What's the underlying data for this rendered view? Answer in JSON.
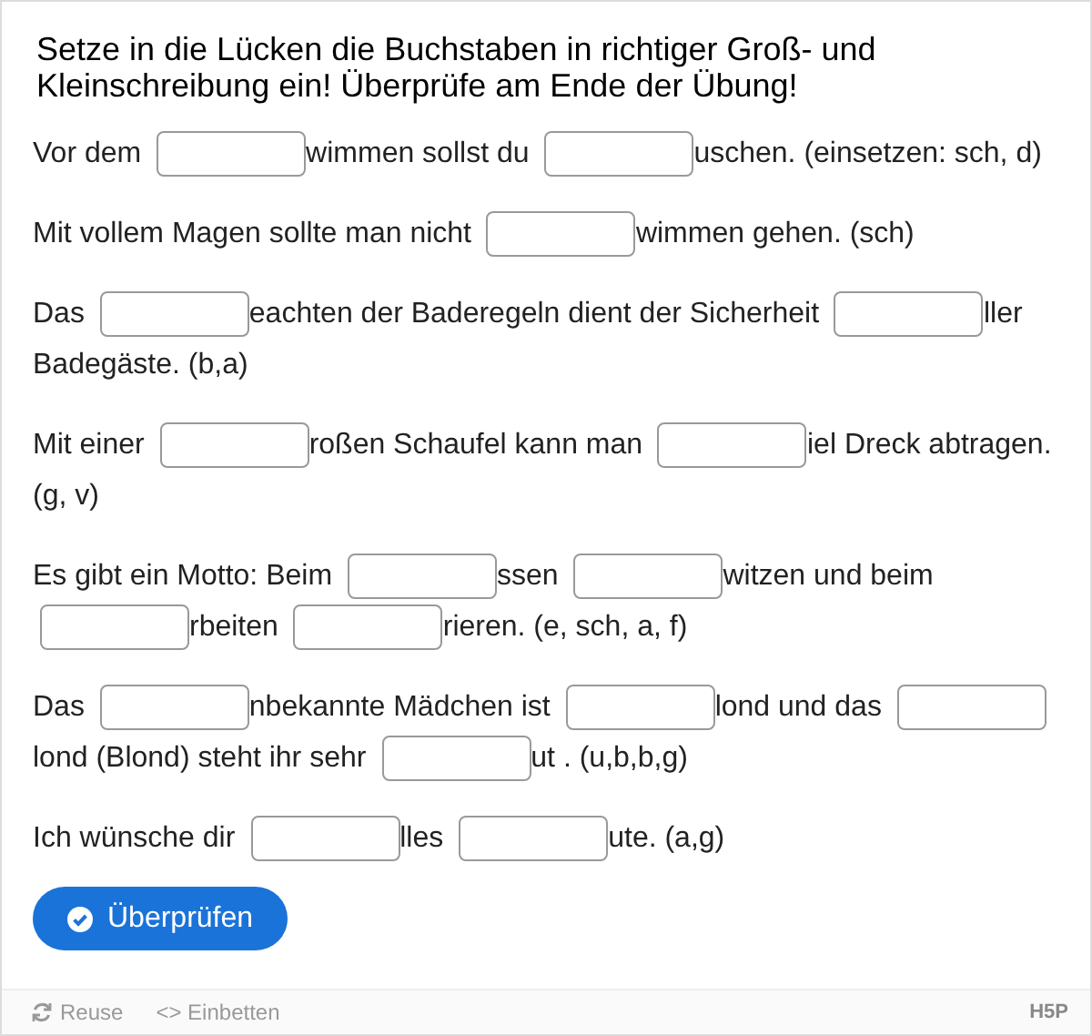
{
  "instruction": "Setze in die Lücken die Buchstaben in richtiger Groß- und Kleinschreibung ein! Überprüfe am Ende der Übung!",
  "paragraphs": [
    {
      "parts": [
        {
          "kind": "text",
          "text": "Vor dem"
        },
        {
          "kind": "blank"
        },
        {
          "kind": "text",
          "text": "wimmen sollst du"
        },
        {
          "kind": "blank"
        },
        {
          "kind": "text",
          "text": "uschen. (einsetzen: sch, d)"
        }
      ]
    },
    {
      "parts": [
        {
          "kind": "text",
          "text": "Mit vollem Magen sollte man nicht"
        },
        {
          "kind": "blank"
        },
        {
          "kind": "text",
          "text": "wimmen gehen.  (sch)"
        }
      ]
    },
    {
      "parts": [
        {
          "kind": "text",
          "text": "Das"
        },
        {
          "kind": "blank"
        },
        {
          "kind": "text",
          "text": "eachten der Baderegeln dient der Sicherheit"
        },
        {
          "kind": "blank"
        },
        {
          "kind": "text",
          "text": "ller"
        },
        {
          "kind": "text",
          "text": "Badegäste. (b,a)"
        }
      ]
    },
    {
      "parts": [
        {
          "kind": "text",
          "text": "Mit einer"
        },
        {
          "kind": "blank"
        },
        {
          "kind": "text",
          "text": "roßen Schaufel kann man"
        },
        {
          "kind": "blank"
        },
        {
          "kind": "text",
          "text": "iel Dreck abtragen."
        },
        {
          "kind": "text",
          "text": "(g, v)"
        }
      ]
    },
    {
      "parts": [
        {
          "kind": "text",
          "text": "Es gibt ein Motto: Beim"
        },
        {
          "kind": "blank"
        },
        {
          "kind": "text",
          "text": "ssen"
        },
        {
          "kind": "blank"
        },
        {
          "kind": "text",
          "text": "witzen und beim"
        },
        {
          "kind": "blank"
        },
        {
          "kind": "text",
          "text": "rbeiten"
        },
        {
          "kind": "blank"
        },
        {
          "kind": "text",
          "text": "rieren. (e, sch, a, f)"
        }
      ]
    },
    {
      "parts": [
        {
          "kind": "text",
          "text": "Das"
        },
        {
          "kind": "blank"
        },
        {
          "kind": "text",
          "text": "nbekannte Mädchen ist"
        },
        {
          "kind": "blank"
        },
        {
          "kind": "text",
          "text": "lond und das"
        },
        {
          "kind": "blank"
        },
        {
          "kind": "text",
          "text": "lond (Blond) steht ihr sehr"
        },
        {
          "kind": "blank"
        },
        {
          "kind": "text",
          "text": "ut . (u,b,b,g)"
        }
      ]
    },
    {
      "parts": [
        {
          "kind": "text",
          "text": "Ich wünsche dir"
        },
        {
          "kind": "blank"
        },
        {
          "kind": "text",
          "text": "lles"
        },
        {
          "kind": "blank"
        },
        {
          "kind": "text",
          "text": "ute. (a,g)"
        }
      ]
    }
  ],
  "check_button": "Überprüfen",
  "footer": {
    "reuse": "Reuse",
    "embed_icon": "<>",
    "embed": "Einbetten",
    "logo": "H5P"
  }
}
